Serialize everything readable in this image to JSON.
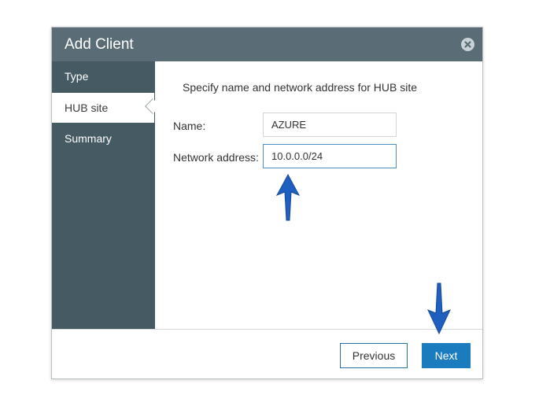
{
  "dialog": {
    "title": "Add Client",
    "close_icon": "close-circle-icon"
  },
  "sidebar": {
    "items": [
      {
        "label": "Type",
        "active": false
      },
      {
        "label": "HUB site",
        "active": true
      },
      {
        "label": "Summary",
        "active": false
      }
    ]
  },
  "main": {
    "instruction": "Specify name and network address for HUB site",
    "name_label": "Name:",
    "name_value": "AZURE",
    "network_label": "Network address:",
    "network_value": "10.0.0.0/24"
  },
  "footer": {
    "previous_label": "Previous",
    "next_label": "Next"
  },
  "colors": {
    "titlebar": "#5a6c75",
    "sidebar": "#465a63",
    "accent": "#1a7bbf",
    "annotation_arrow": "#1f5fbf"
  }
}
